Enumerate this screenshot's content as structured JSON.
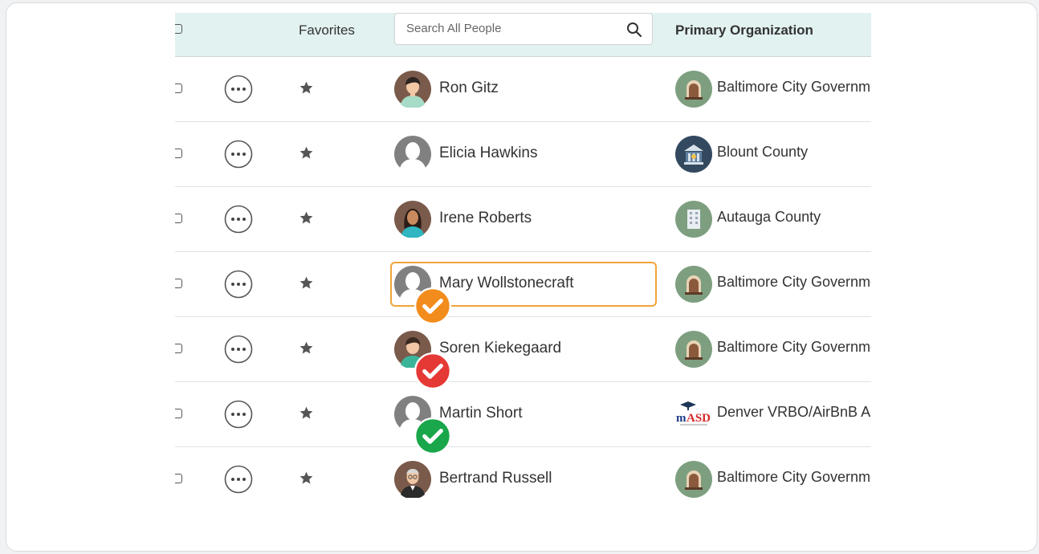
{
  "header": {
    "favorites_label": "Favorites",
    "search_placeholder": "Search All People",
    "org_label": "Primary Organization"
  },
  "colors": {
    "header_bg": "#e2f2f1",
    "focus_outline": "#f0a43a",
    "star": "#555555",
    "org_logo_green": "#7d9f80"
  },
  "rows": [
    {
      "name": "Ron Gitz",
      "avatar": "man-avatar-icon",
      "badge": null,
      "org": "Baltimore City Government",
      "org_logo": "doorway-logo-icon"
    },
    {
      "name": "Elicia Hawkins",
      "avatar": "default-person-icon",
      "badge": null,
      "org": "Blount County",
      "org_logo": "courthouse-logo-icon"
    },
    {
      "name": "Irene Roberts",
      "avatar": "woman-avatar-icon",
      "badge": null,
      "org": "Autauga County",
      "org_logo": "building-logo-icon"
    },
    {
      "name": "Mary Wollstonecraft",
      "avatar": "default-person-icon",
      "badge": "orange-check-badge-icon",
      "org": "Baltimore City Government",
      "org_logo": "doorway-logo-icon",
      "focused": true
    },
    {
      "name": "Soren Kiekegaard",
      "avatar": "man-avatar-icon",
      "badge": "red-check-badge-icon",
      "org": "Baltimore City Government",
      "org_logo": "doorway-logo-icon"
    },
    {
      "name": "Martin Short",
      "avatar": "default-person-icon",
      "badge": "green-check-badge-icon",
      "org": "Denver VRBO/AirBnB Association",
      "org_logo": "masd-logo-icon"
    },
    {
      "name": "Bertrand Russell",
      "avatar": "old-man-avatar-icon",
      "badge": null,
      "org": "Baltimore City Government",
      "org_logo": "doorway-logo-icon"
    }
  ]
}
